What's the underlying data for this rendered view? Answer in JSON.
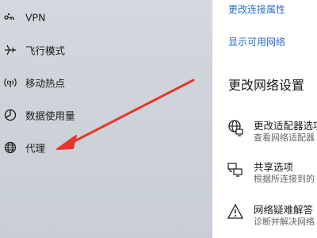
{
  "sidebar": {
    "items": [
      {
        "label": "VPN",
        "icon": "vpn-icon"
      },
      {
        "label": "飞行模式",
        "icon": "airplane-icon"
      },
      {
        "label": "移动热点",
        "icon": "hotspot-icon"
      },
      {
        "label": "数据使用量",
        "icon": "data-usage-icon"
      },
      {
        "label": "代理",
        "icon": "globe-icon"
      }
    ]
  },
  "main": {
    "link_change_properties": "更改连接属性",
    "link_show_networks": "显示可用网络",
    "section_title": "更改网络设置",
    "settings": [
      {
        "title": "更改适配器选项",
        "desc": "查看网络适配器",
        "icon": "adapter-icon"
      },
      {
        "title": "共享选项",
        "desc": "根据所连接到的",
        "icon": "sharing-icon"
      },
      {
        "title": "网络疑难解答",
        "desc": "诊断并解决网络",
        "icon": "warning-icon"
      }
    ]
  },
  "annotation": {
    "type": "red-arrow",
    "color": "#e8352b",
    "points_to": "代理"
  },
  "colors": {
    "accent_link": "#2a6fc4",
    "sidebar_bg": "#cfd4da"
  }
}
